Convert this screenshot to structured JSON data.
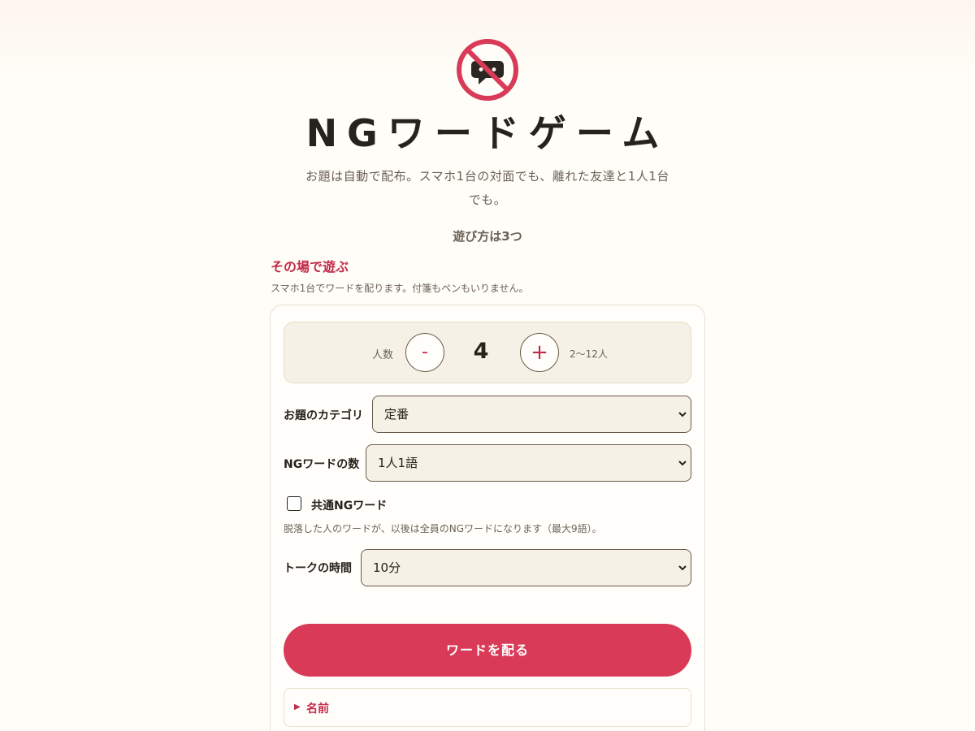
{
  "header": {
    "title": "NGワードゲーム",
    "subtitle": "お題は自動で配布。スマホ1台の対面でも、離れた友達と1人1台でも。",
    "howto": "遊び方は3つ"
  },
  "section": {
    "title": "その場で遊ぶ",
    "description": "スマホ1台でワードを配ります。付箋もペンもいりません。"
  },
  "players": {
    "label": "人数",
    "minus_label": "-",
    "plus_label": "+",
    "count": "4",
    "range": "2〜12人"
  },
  "category": {
    "label": "お題のカテゴリ",
    "selected": "定番"
  },
  "ng_count": {
    "label": "NGワードの数",
    "selected": "1人1語"
  },
  "shared_ng": {
    "label": "共通NGワード",
    "checked": false,
    "description": "脱落した人のワードが、以後は全員のNGワードになります（最大9語）。"
  },
  "talk_time": {
    "label": "トークの時間",
    "selected": "10分"
  },
  "deal_button": {
    "label": "ワードを配る"
  },
  "names": {
    "arrow": "▶",
    "label": "名前"
  },
  "colors": {
    "accent": "#d83a58",
    "accent_text": "#c42a4a",
    "background": "#fffdf7",
    "panel": "#f6f1e6"
  },
  "icons": {
    "logo": "no-chat-icon",
    "select_arrow": "chevron-down-icon"
  }
}
